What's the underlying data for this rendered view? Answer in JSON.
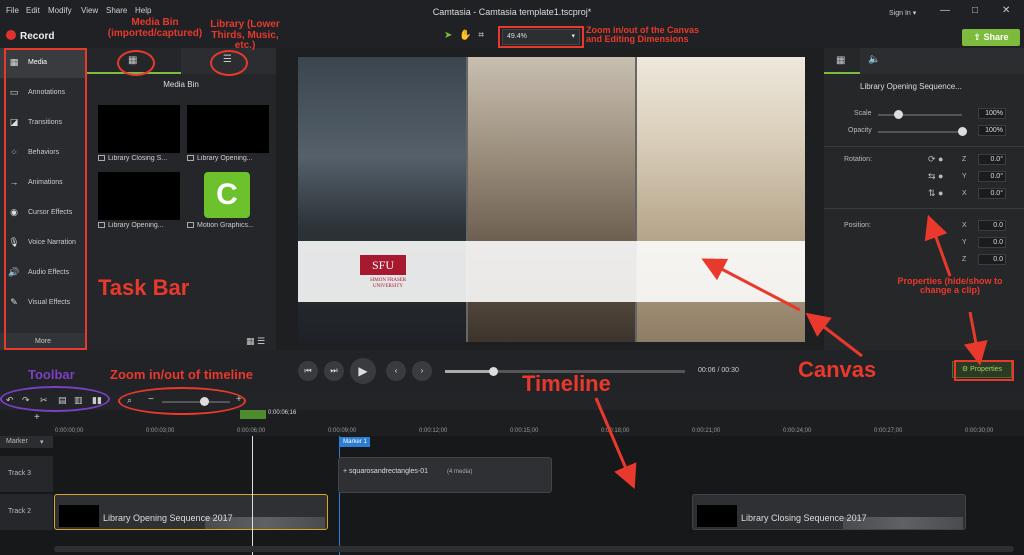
{
  "menu": [
    "File",
    "Edit",
    "Modify",
    "View",
    "Share",
    "Help"
  ],
  "window": {
    "title": "Camtasia - Camtasia template1.tscproj*",
    "signin": "Sign In",
    "min": "—",
    "max": "□",
    "close": "✕"
  },
  "record": {
    "label": "Record"
  },
  "zoom": {
    "value": "49.4%"
  },
  "share": {
    "label": "Share"
  },
  "nav": {
    "items": [
      "Media",
      "Annotations",
      "Transitions",
      "Behaviors",
      "Animations",
      "Cursor Effects",
      "Voice Narration",
      "Audio Effects",
      "Visual Effects"
    ],
    "more": "More"
  },
  "bin": {
    "title": "Media Bin",
    "items": [
      "Library Closing S...",
      "Library Opening...",
      "Library Opening...",
      "Motion Graphics..."
    ],
    "logo": "C"
  },
  "canvas": {
    "logo": "SFU",
    "logo_sub": "SIMON FRASER UNIVERSITY"
  },
  "props": {
    "title": "Library Opening Sequence...",
    "scale_label": "Scale",
    "scale": "100%",
    "opacity_label": "Opacity",
    "opacity": "100%",
    "rotation_label": "Rotation:",
    "rz": "0.0°",
    "ry": "0.0°",
    "rx": "0.0°",
    "position_label": "Position:",
    "px": "0.0",
    "py": "0.0",
    "pz": "0.0",
    "axis_z": "Z",
    "axis_y": "Y",
    "axis_x": "X",
    "button": "Properties"
  },
  "player": {
    "time": "00:06 / 00:30",
    "progress": 0.2
  },
  "timeline": {
    "playhead": "0:00:06;16",
    "marker_label": "Marker",
    "marker_badge": "Marker 1",
    "ticks": [
      "0:00:00;00",
      "0:00:03;00",
      "0:00:06;00",
      "0:00:09;00",
      "0:00:12;00",
      "0:00:15;00",
      "0:00:18;00",
      "0:00:21;00",
      "0:00:24;00",
      "0:00:27;00",
      "0:00:30;00"
    ],
    "tracks": [
      "Track 3",
      "Track 2"
    ],
    "clip_group": "+ squarosandrectangles-01",
    "clip_group_count": "(4 media)",
    "clip1": "Library Opening Sequence 2017",
    "clip2": "Library Closing Sequence 2017"
  },
  "annotations": {
    "media_bin": "Media Bin (imported/captured)",
    "library": "Library (Lower Thirds, Music, etc.)",
    "zoom_canvas": "Zoom in/out of the Canvas and Editing Dimensions",
    "task_bar": "Task Bar",
    "properties": "Properties (hide/show to change a clip)",
    "canvas": "Canvas",
    "timeline": "Timeline",
    "toolbar": "Toolbar",
    "zoom_timeline": "Zoom in/out of timeline"
  }
}
